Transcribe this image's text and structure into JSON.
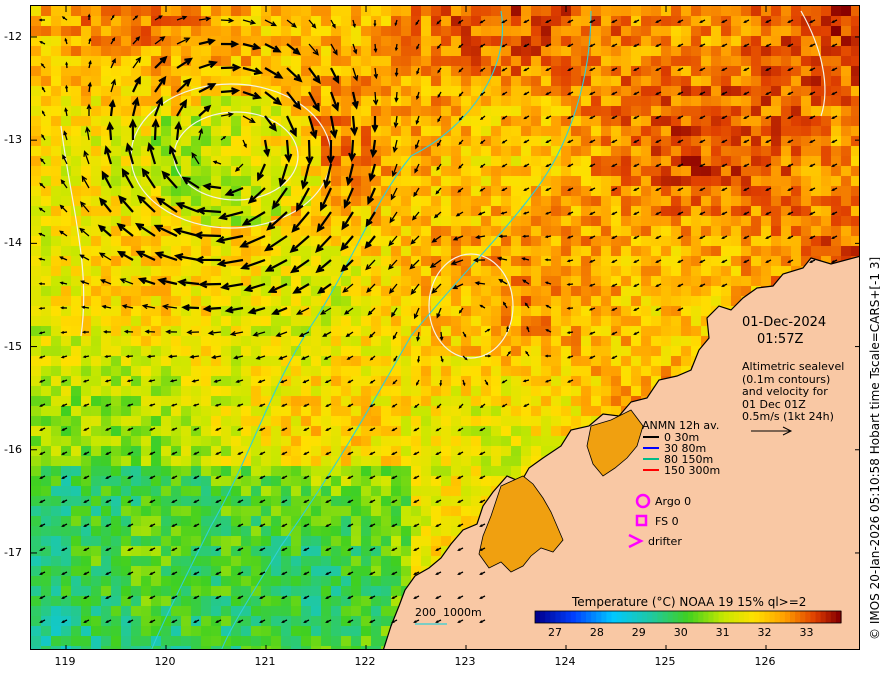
{
  "map": {
    "date": "01-Dec-2024",
    "time": "01:57Z",
    "lat_ticks": [
      "-12",
      "-13",
      "-14",
      "-15",
      "-16",
      "-17"
    ],
    "lon_ticks": [
      "119",
      "120",
      "121",
      "122",
      "123",
      "124",
      "125",
      "126"
    ],
    "lat_range": [
      -17.95,
      -11.7
    ],
    "lon_range": [
      118.65,
      126.95
    ]
  },
  "info": {
    "line1": "Altimetric sealevel",
    "line2": "(0.1m contours)",
    "line3": "and velocity for",
    "line4": "01 Dec 01Z",
    "line5": "0.5m/s (1kt 24h)"
  },
  "legend": {
    "title": "ANMN 12h av.",
    "items": [
      {
        "label": "0 30m",
        "color": "#000000"
      },
      {
        "label": "30 80m",
        "color": "#0000ff"
      },
      {
        "label": "80 150m",
        "color": "#00bb88"
      },
      {
        "label": "150 300m",
        "color": "#ff0000"
      }
    ],
    "argo": "Argo 0",
    "fs": "FS 0",
    "drifter": "drifter",
    "argo_color": "#ff00ff"
  },
  "depth_label": "200  1000m",
  "colorbar": {
    "title": "Temperature (°C) NOAA 19 15% ql>=2",
    "ticks": [
      "27",
      "28",
      "29",
      "30",
      "31",
      "32",
      "33"
    ],
    "range": [
      26.5,
      33.8
    ]
  },
  "credit": "© IMOS 20-Jan-2026 05:10:58 Hobart time Tscale=CARS+[-1 3]",
  "colors": {
    "land": "#f9c8a4",
    "contour": "#f4f4ea",
    "isobath": "#30d0d8"
  }
}
